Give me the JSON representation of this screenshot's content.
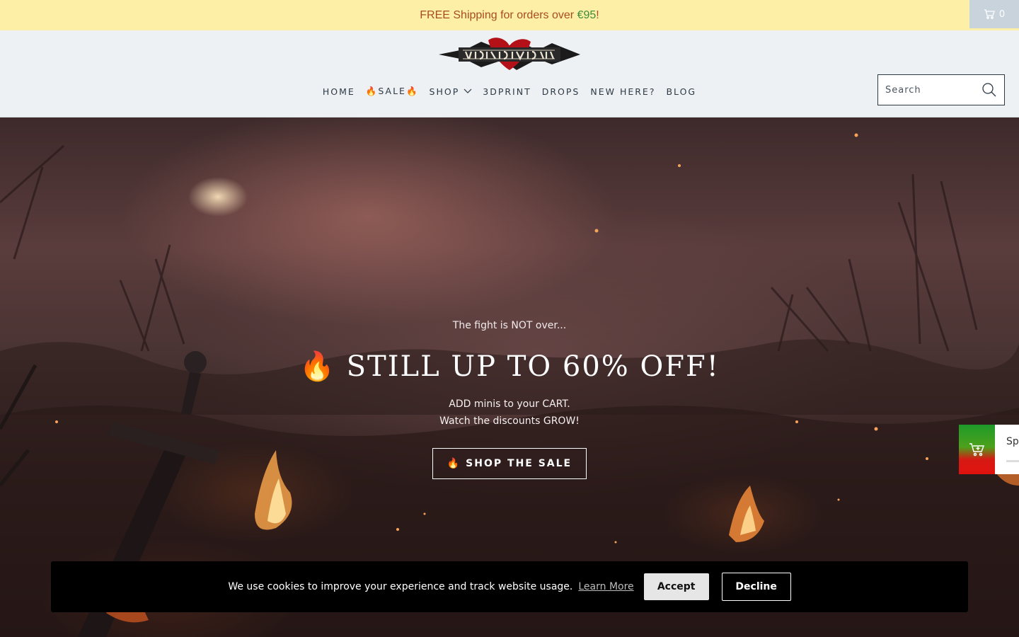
{
  "announcement": {
    "text_prefix": "FREE Shipping for orders over ",
    "price": "€95",
    "text_suffix": "!"
  },
  "cart": {
    "count": "0",
    "icon": "cart-icon"
  },
  "header": {
    "nav": [
      {
        "label": "HOME"
      },
      {
        "label": "🔥SALE🔥"
      },
      {
        "label": "SHOP",
        "has_dropdown": true
      },
      {
        "label": "3DPRINT"
      },
      {
        "label": "DROPS"
      },
      {
        "label": "NEW HERE?"
      },
      {
        "label": "BLOG"
      }
    ],
    "search": {
      "placeholder": "Search",
      "icon": "search-icon"
    }
  },
  "hero": {
    "pre_title": "The fight is NOT over...",
    "title": "🔥 STILL UP TO 60% OFF!",
    "sub_line1": "ADD minis to your CART.",
    "sub_line2": "Watch the discounts GROW!",
    "button": "🔥 SHOP THE SALE"
  },
  "side_widget": {
    "label": "Sp",
    "icon": "cart-plus-icon"
  },
  "cookie": {
    "text": "We use cookies to improve your experience and track website usage.",
    "link": "Learn More",
    "accept": "Accept",
    "decline": "Decline"
  },
  "colors": {
    "announce_bg": "#fdf0a6",
    "announce_text": "#a84b22",
    "price_text": "#3e8a3a",
    "header_bg": "#eef1f4",
    "nav_text": "#2d3a45"
  }
}
